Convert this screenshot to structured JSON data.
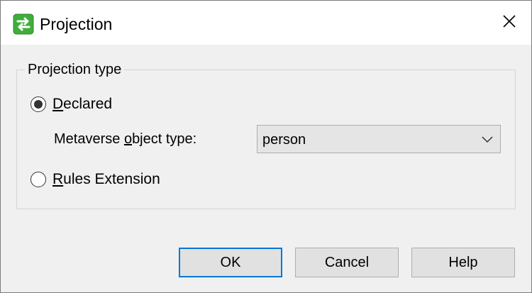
{
  "window": {
    "title": "Projection",
    "icon": "projection-arrows-icon",
    "close_icon": "close-icon"
  },
  "projection_type": {
    "group_label": "Projection type",
    "declared": {
      "label_prefix": "",
      "label_accel": "D",
      "label_rest": "eclared",
      "selected": true
    },
    "metaverse": {
      "label_pre": "Metaverse ",
      "label_accel": "o",
      "label_post": "bject type:",
      "selected_value": "person"
    },
    "rules_extension": {
      "label_accel": "R",
      "label_rest": "ules Extension",
      "selected": false
    }
  },
  "buttons": {
    "ok": "OK",
    "cancel": "Cancel",
    "help": "Help"
  },
  "colors": {
    "titlebar": "#ffffff",
    "dialog_background": "#f0f0f0",
    "default_button_border": "#0078d7",
    "icon_green": "#3fae3a"
  }
}
